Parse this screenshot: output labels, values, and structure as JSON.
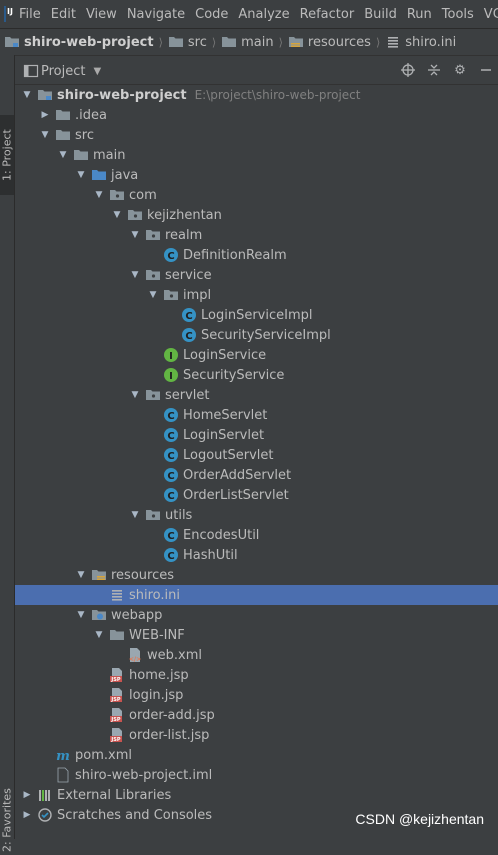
{
  "menubar": {
    "items": [
      "File",
      "Edit",
      "View",
      "Navigate",
      "Code",
      "Analyze",
      "Refactor",
      "Build",
      "Run",
      "Tools",
      "VC"
    ]
  },
  "breadcrumb": {
    "items": [
      "shiro-web-project",
      "src",
      "main",
      "resources",
      "shiro.ini"
    ]
  },
  "side_tabs": {
    "project": "1: Project",
    "favorites": "2: Favorites"
  },
  "panel": {
    "title": "Project"
  },
  "tree": [
    {
      "label": "shiro-web-project",
      "path": "E:\\project\\shiro-web-project",
      "depth": 0,
      "expanded": true,
      "icon": "module-folder-icon",
      "bold": true
    },
    {
      "label": ".idea",
      "depth": 1,
      "expanded": false,
      "icon": "folder-icon"
    },
    {
      "label": "src",
      "depth": 1,
      "expanded": true,
      "icon": "folder-icon"
    },
    {
      "label": "main",
      "depth": 2,
      "expanded": true,
      "icon": "folder-icon"
    },
    {
      "label": "java",
      "depth": 3,
      "expanded": true,
      "icon": "source-folder-icon"
    },
    {
      "label": "com",
      "depth": 4,
      "expanded": true,
      "icon": "package-icon"
    },
    {
      "label": "kejizhentan",
      "depth": 5,
      "expanded": true,
      "icon": "package-icon"
    },
    {
      "label": "realm",
      "depth": 6,
      "expanded": true,
      "icon": "package-icon"
    },
    {
      "label": "DefinitionRealm",
      "depth": 7,
      "icon": "class-icon"
    },
    {
      "label": "service",
      "depth": 6,
      "expanded": true,
      "icon": "package-icon"
    },
    {
      "label": "impl",
      "depth": 7,
      "expanded": true,
      "icon": "package-icon"
    },
    {
      "label": "LoginServiceImpl",
      "depth": 8,
      "icon": "class-icon"
    },
    {
      "label": "SecurityServiceImpl",
      "depth": 8,
      "icon": "class-icon"
    },
    {
      "label": "LoginService",
      "depth": 7,
      "icon": "interface-icon"
    },
    {
      "label": "SecurityService",
      "depth": 7,
      "icon": "interface-icon"
    },
    {
      "label": "servlet",
      "depth": 6,
      "expanded": true,
      "icon": "package-icon"
    },
    {
      "label": "HomeServlet",
      "depth": 7,
      "icon": "class-icon"
    },
    {
      "label": "LoginServlet",
      "depth": 7,
      "icon": "class-icon"
    },
    {
      "label": "LogoutServlet",
      "depth": 7,
      "icon": "class-icon"
    },
    {
      "label": "OrderAddServlet",
      "depth": 7,
      "icon": "class-icon"
    },
    {
      "label": "OrderListServlet",
      "depth": 7,
      "icon": "class-icon"
    },
    {
      "label": "utils",
      "depth": 6,
      "expanded": true,
      "icon": "package-icon"
    },
    {
      "label": "EncodesUtil",
      "depth": 7,
      "icon": "class-icon"
    },
    {
      "label": "HashUtil",
      "depth": 7,
      "icon": "class-icon"
    },
    {
      "label": "resources",
      "depth": 3,
      "expanded": true,
      "icon": "resources-folder-icon"
    },
    {
      "label": "shiro.ini",
      "depth": 4,
      "icon": "ini-file-icon",
      "selected": true
    },
    {
      "label": "webapp",
      "depth": 3,
      "expanded": true,
      "icon": "web-folder-icon"
    },
    {
      "label": "WEB-INF",
      "depth": 4,
      "expanded": true,
      "icon": "folder-icon"
    },
    {
      "label": "web.xml",
      "depth": 5,
      "icon": "xml-file-icon"
    },
    {
      "label": "home.jsp",
      "depth": 4,
      "icon": "jsp-file-icon"
    },
    {
      "label": "login.jsp",
      "depth": 4,
      "icon": "jsp-file-icon"
    },
    {
      "label": "order-add.jsp",
      "depth": 4,
      "icon": "jsp-file-icon"
    },
    {
      "label": "order-list.jsp",
      "depth": 4,
      "icon": "jsp-file-icon"
    },
    {
      "label": "pom.xml",
      "depth": 1,
      "icon": "maven-icon"
    },
    {
      "label": "shiro-web-project.iml",
      "depth": 1,
      "icon": "iml-file-icon"
    },
    {
      "label": "External Libraries",
      "depth": 0,
      "expanded": false,
      "icon": "libraries-icon"
    },
    {
      "label": "Scratches and Consoles",
      "depth": 0,
      "expanded": false,
      "icon": "scratches-icon"
    }
  ],
  "watermark": "CSDN @kejizhentan"
}
